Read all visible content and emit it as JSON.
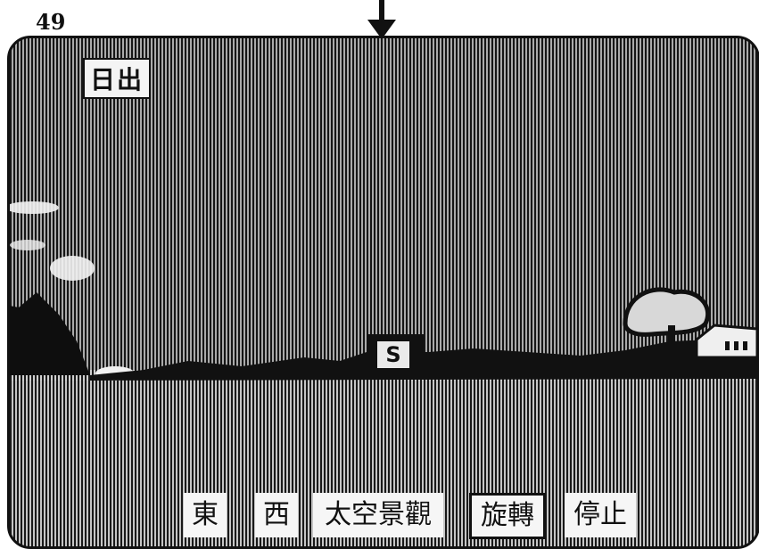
{
  "page_number": "49",
  "screen": {
    "mode_label": "日出",
    "marker_letter": "S"
  },
  "menu": {
    "east": "東",
    "west": "西",
    "space_view": "太空景觀",
    "rotate": "旋轉",
    "stop": "停止",
    "active_item": "旋轉"
  },
  "icons": [
    "down-arrow-icon"
  ],
  "colors": {
    "screen_dark": "#1b1b1b",
    "screen_light": "#d0d0d0",
    "button_bg": "#f6f6f6"
  }
}
